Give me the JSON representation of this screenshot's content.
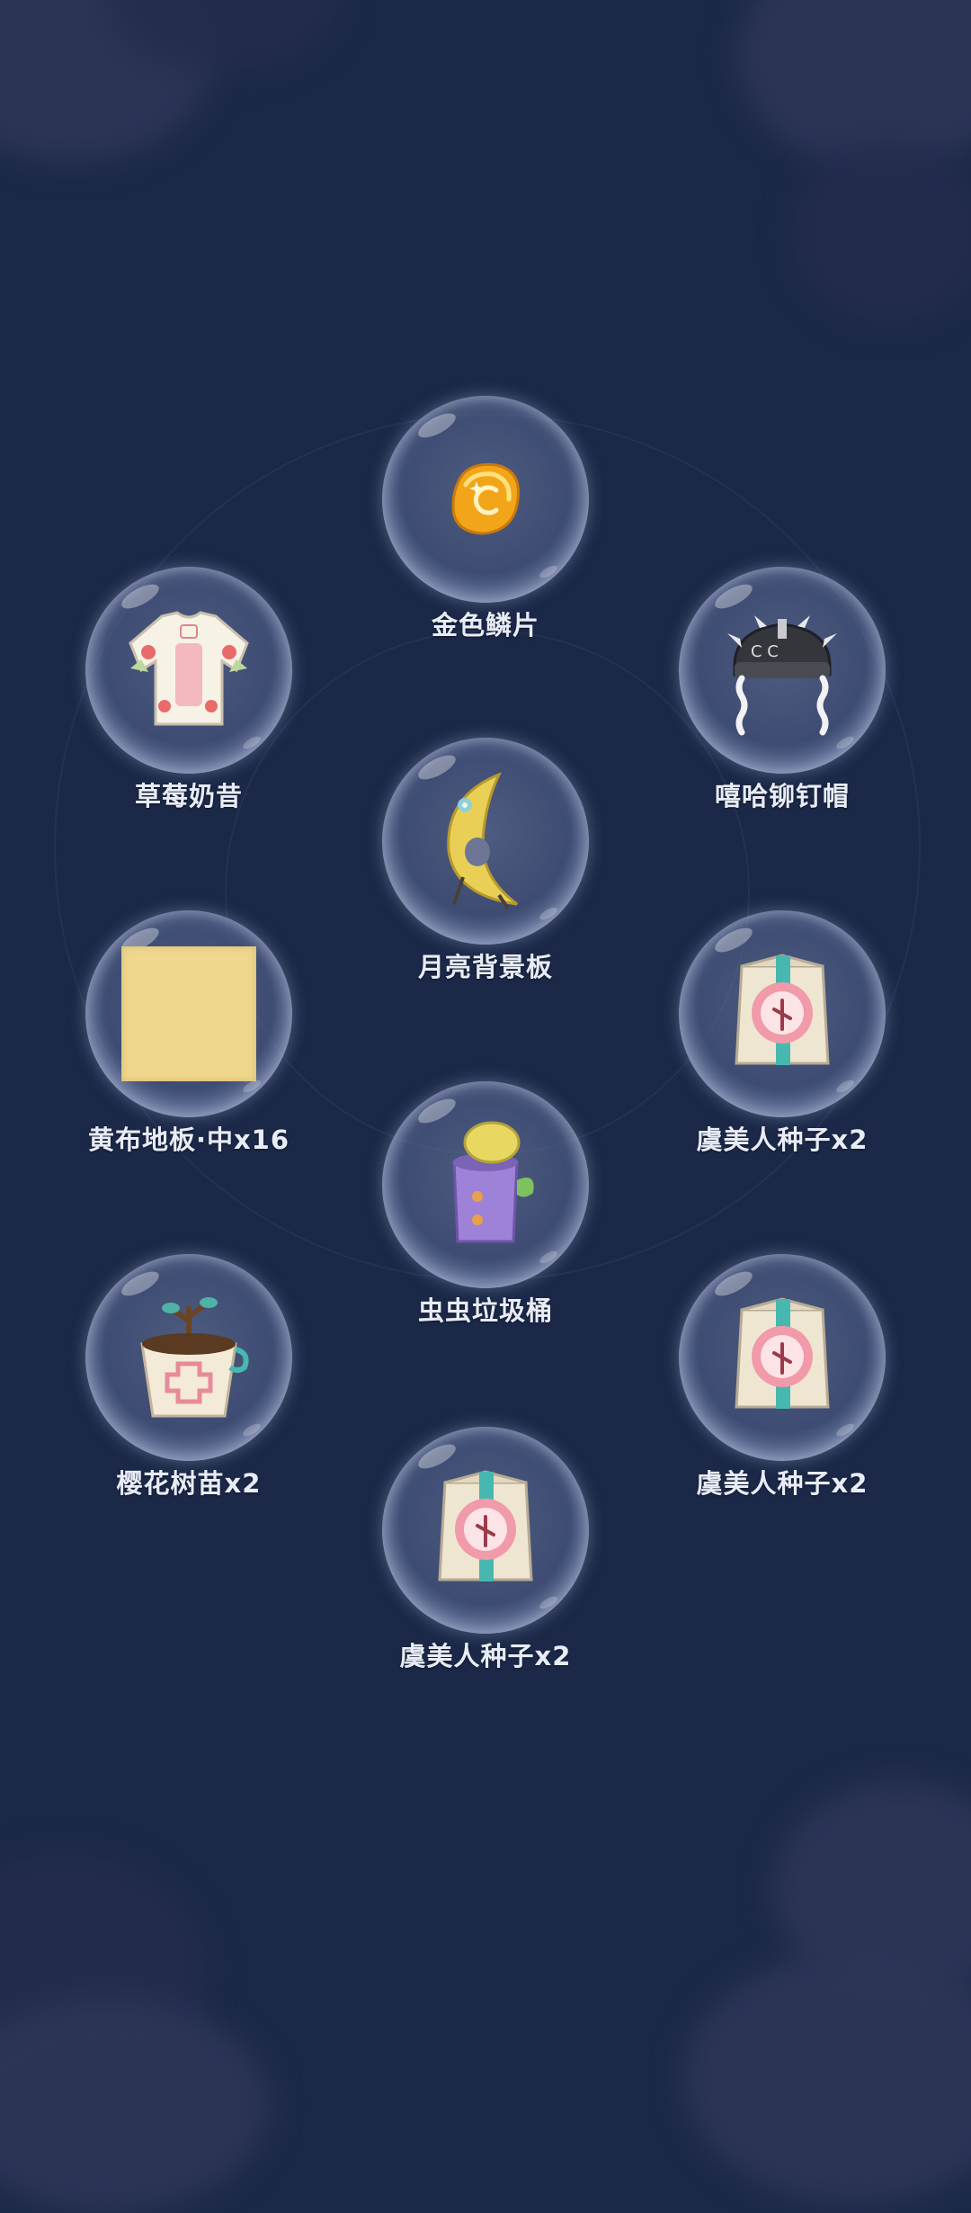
{
  "colors": {
    "background": "#1b2848",
    "label": "#e8ecf6",
    "bubble_rim": "#c8d2eb"
  },
  "rewards": [
    {
      "label": "金色鳞片",
      "icon": "gold-scale-icon"
    },
    {
      "label": "草莓奶昔",
      "icon": "strawberry-shirt-icon"
    },
    {
      "label": "嘻哈铆钉帽",
      "icon": "studded-hat-icon"
    },
    {
      "label": "月亮背景板",
      "icon": "moon-backdrop-icon"
    },
    {
      "label": "黄布地板·中x16",
      "icon": "yellow-floor-tile-icon"
    },
    {
      "label": "虞美人种子x2",
      "icon": "poppy-seed-bag-icon"
    },
    {
      "label": "虫虫垃圾桶",
      "icon": "bug-trash-can-icon"
    },
    {
      "label": "樱花树苗x2",
      "icon": "cherry-sapling-pot-icon"
    },
    {
      "label": "虞美人种子x2",
      "icon": "poppy-seed-bag-icon"
    },
    {
      "label": "虞美人种子x2",
      "icon": "poppy-seed-bag-icon"
    }
  ]
}
